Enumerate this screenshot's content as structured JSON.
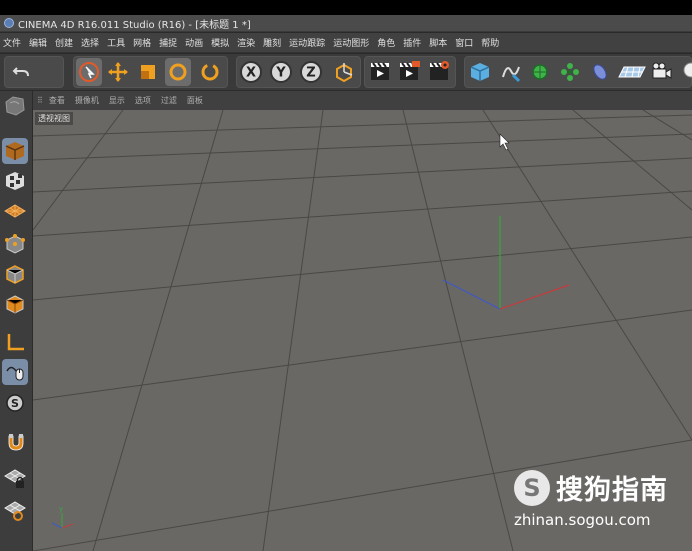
{
  "title_bar": {
    "title": "CINEMA 4D R16.011 Studio (R16) - [未标题 1 *]"
  },
  "menu": [
    "文件",
    "编辑",
    "创建",
    "选择",
    "工具",
    "网格",
    "捕捉",
    "动画",
    "模拟",
    "渲染",
    "雕刻",
    "运动跟踪",
    "运动图形",
    "角色",
    "插件",
    "脚本",
    "窗口",
    "帮助"
  ],
  "viewport_menu": [
    "查看",
    "摄像机",
    "显示",
    "选项",
    "过滤",
    "面板"
  ],
  "viewport": {
    "label": "透视视图"
  },
  "watermark": {
    "brand": "搜狗指南",
    "url": "zhinan.sogou.com",
    "logo_letter": "S"
  },
  "icons": {
    "toolbar": [
      "undo-icon",
      "live-select-icon",
      "move-icon",
      "scale-icon",
      "rotate-icon",
      "rotate-alt-icon",
      "x-axis-icon",
      "y-axis-icon",
      "z-axis-icon",
      "world-coord-icon",
      "render-view-icon",
      "render-picture-queue-icon",
      "render-settings-icon",
      "cube-icon",
      "spline-pen-icon",
      "subdivision-icon",
      "array-icon",
      "deformer-icon",
      "floor-icon",
      "camera-icon",
      "light-icon"
    ],
    "left": [
      "model-mode-icon",
      "texture-mode-icon",
      "workplane-mode-icon",
      "point-mode-icon",
      "edge-mode-icon",
      "polygon-mode-icon",
      "axis-mode-icon",
      "tweak-mode-icon",
      "solo-mode-icon",
      "snap-icon",
      "workplane-lock-icon",
      "planar-workplane-icon"
    ]
  },
  "colors": {
    "viewport_bg": "#6a6865",
    "accent_orange": "#e08a1e",
    "axis_x": "#c43c3c",
    "axis_y": "#3ca83c",
    "axis_z": "#3c5ac4"
  }
}
